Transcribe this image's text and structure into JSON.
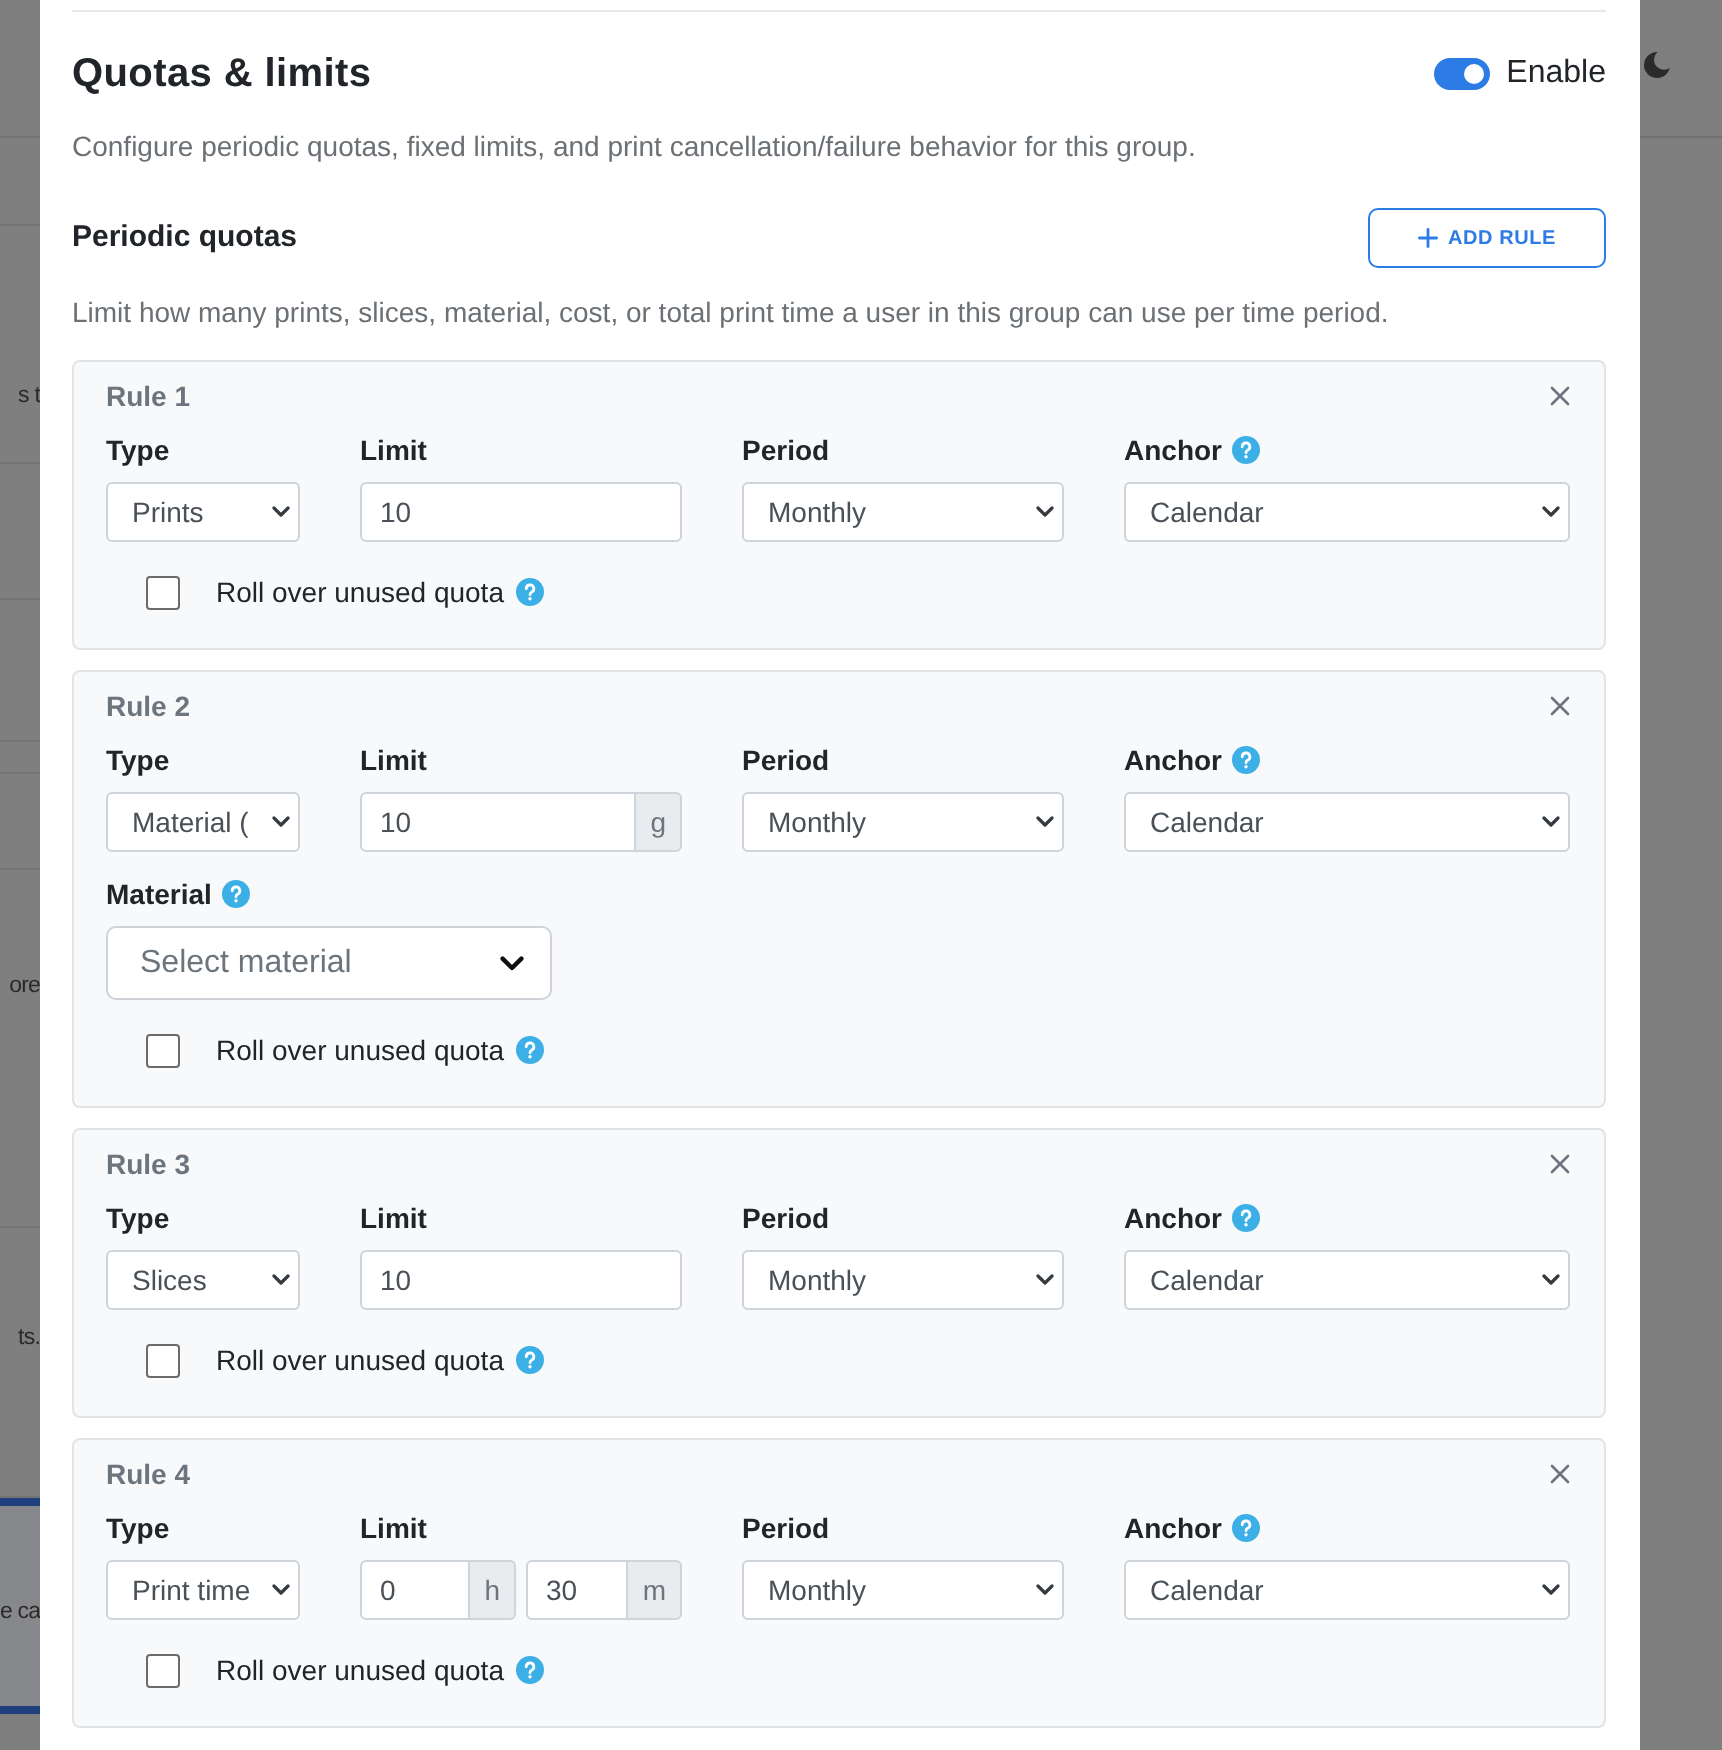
{
  "background_page": {
    "text_fragments": [
      "s t",
      "ore",
      "ts.",
      "e ca"
    ]
  },
  "quotas_section": {
    "title": "Quotas & limits",
    "enable_switch": {
      "label": "Enable",
      "on": true
    },
    "description": "Configure periodic quotas, fixed limits, and print cancellation/failure behavior for this group."
  },
  "periodic_quotas": {
    "title": "Periodic quotas",
    "add_button": "ADD RULE",
    "description": "Limit how many prints, slices, material, cost, or total print time a user in this group can use per time period.",
    "rules": [
      {
        "title": "Rule 1",
        "type": {
          "label": "Type",
          "value": "Prints"
        },
        "limit": {
          "label": "Limit",
          "inputs": [
            {
              "value": "10"
            }
          ]
        },
        "period": {
          "label": "Period",
          "value": "Monthly"
        },
        "anchor": {
          "label": "Anchor",
          "value": "Calendar"
        },
        "rollover": {
          "label": "Roll over unused quota",
          "checked": false
        }
      },
      {
        "title": "Rule 2",
        "type": {
          "label": "Type",
          "value": "Material ("
        },
        "limit": {
          "label": "Limit",
          "inputs": [
            {
              "value": "10",
              "unit": "g"
            }
          ]
        },
        "period": {
          "label": "Period",
          "value": "Monthly"
        },
        "anchor": {
          "label": "Anchor",
          "value": "Calendar"
        },
        "material": {
          "label": "Material",
          "placeholder": "Select material"
        },
        "rollover": {
          "label": "Roll over unused quota",
          "checked": false
        }
      },
      {
        "title": "Rule 3",
        "type": {
          "label": "Type",
          "value": "Slices"
        },
        "limit": {
          "label": "Limit",
          "inputs": [
            {
              "value": "10"
            }
          ]
        },
        "period": {
          "label": "Period",
          "value": "Monthly"
        },
        "anchor": {
          "label": "Anchor",
          "value": "Calendar"
        },
        "rollover": {
          "label": "Roll over unused quota",
          "checked": false
        }
      },
      {
        "title": "Rule 4",
        "type": {
          "label": "Type",
          "value": "Print time"
        },
        "limit": {
          "label": "Limit",
          "inputs": [
            {
              "value": "0",
              "unit": "h"
            },
            {
              "value": "30",
              "unit": "m"
            }
          ]
        },
        "period": {
          "label": "Period",
          "value": "Monthly"
        },
        "anchor": {
          "label": "Anchor",
          "value": "Calendar"
        },
        "rollover": {
          "label": "Roll over unused quota",
          "checked": false
        }
      }
    ]
  }
}
